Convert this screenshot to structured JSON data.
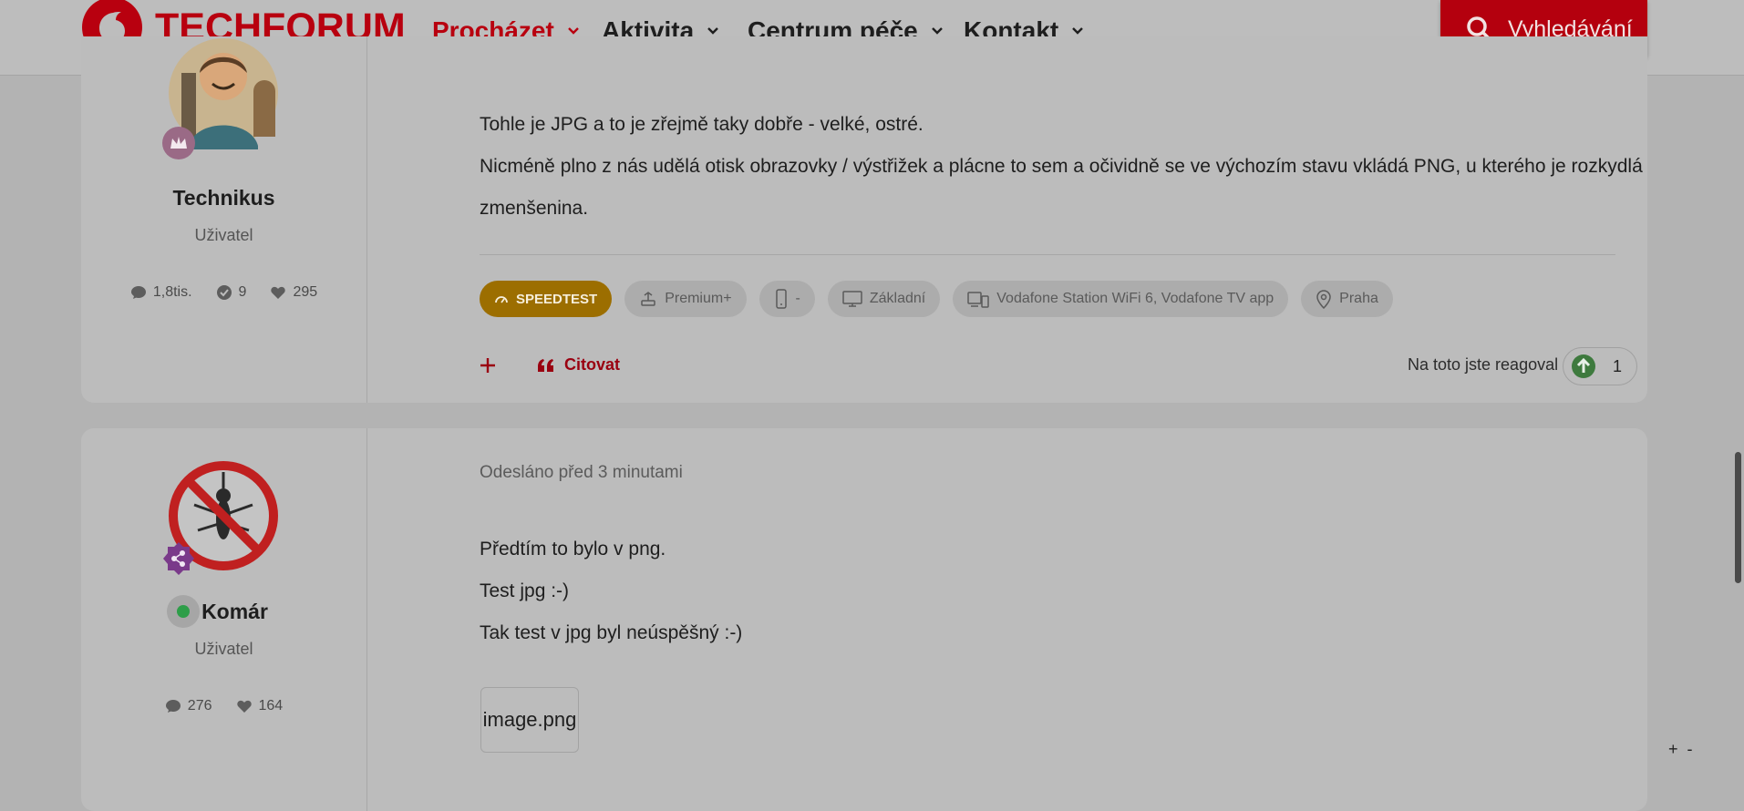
{
  "header": {
    "logo_text": "TECHFORUM",
    "nav": [
      {
        "label": "Procházet",
        "active": true
      },
      {
        "label": "Aktivita",
        "active": false
      },
      {
        "label": "Centrum péče",
        "active": false
      },
      {
        "label": "Kontakt",
        "active": false
      }
    ],
    "search_label": "Vyhledávání"
  },
  "colors": {
    "brand": "#b8000f",
    "speedtest": "#9c6e00",
    "reaction_green": "#3e7a3e",
    "online": "#2e9e49"
  },
  "post1": {
    "author": {
      "name": "Technikus",
      "role": "Uživatel",
      "posts": "1,8tis.",
      "solutions": "9",
      "likes": "295"
    },
    "lines": [
      "Tohle je JPG a to je zřejmě taky dobře - velké, ostré.",
      "Nicméně plno z nás udělá otisk obrazovky / výstřižek a plácne to sem a očividně se ve výchozím stavu vkládá PNG, u kterého je rozkydlá",
      "zmenšenina."
    ],
    "tags": [
      "SPEEDTEST",
      "Premium+",
      "-",
      "Základní",
      "Vodafone Station WiFi 6, Vodafone TV app",
      "Praha"
    ],
    "actions": {
      "quote": "Citovat"
    },
    "reaction": {
      "text": "Na toto jste reagoval",
      "count": "1"
    }
  },
  "post2": {
    "author": {
      "name": "Komár",
      "role": "Uživatel",
      "posts": "276",
      "likes": "164"
    },
    "meta": "Odesláno před 3 minutami",
    "lines": [
      "Předtím to bylo v png.",
      "Test jpg :-)",
      "Tak test v jpg byl neúspěšný :-)"
    ],
    "attachment": "image.png"
  },
  "zoom": {
    "plus": "+",
    "minus": "-"
  }
}
